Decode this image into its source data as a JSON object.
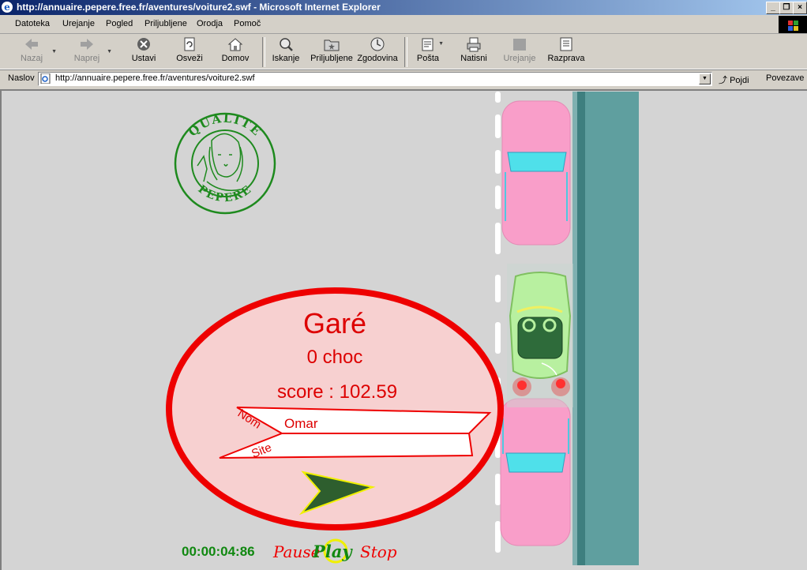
{
  "window": {
    "title": "http://annuaire.pepere.free.fr/aventures/voiture2.swf - Microsoft Internet Explorer",
    "controls": [
      "_",
      "❐",
      "×"
    ]
  },
  "menu": [
    {
      "label": "Datoteka"
    },
    {
      "label": "Urejanje"
    },
    {
      "label": "Pogled"
    },
    {
      "label": "Priljubljene"
    },
    {
      "label": "Orodja"
    },
    {
      "label": "Pomoč"
    }
  ],
  "toolbar": {
    "back": "Nazaj",
    "forward": "Naprej",
    "stop": "Ustavi",
    "refresh": "Osveži",
    "home": "Domov",
    "search": "Iskanje",
    "favorites": "Priljubljene",
    "history": "Zgodovina",
    "mail": "Pošta",
    "print": "Natisni",
    "edit": "Urejanje",
    "discuss": "Razprava"
  },
  "address": {
    "label": "Naslov",
    "url": "http://annuaire.pepere.free.fr/aventures/voiture2.swf",
    "go": "Pojdi",
    "links": "Povezave"
  },
  "game": {
    "logo_text_top": "QUALITE",
    "logo_text_bottom": "PEPERE",
    "status": "Garé",
    "hits": "0 choc",
    "score": "score : 102.59",
    "name_label": "Nom",
    "name_value": "Omar",
    "site_label": "Site",
    "site_value": "",
    "timer": "00:00:04:86",
    "pause": "Pause",
    "play": "Play",
    "stop": "Stop"
  },
  "colors": {
    "titlebar_start": "#0a246a",
    "titlebar_end": "#a6caf0",
    "ellipse_border": "#ee0000",
    "ellipse_fill": "#f7d0d0",
    "score_text": "#dd0000",
    "timer_text": "#008000",
    "car_pink": "#f99ec9",
    "car_green": "#b8f0a0",
    "water": "#5f9f9f"
  }
}
